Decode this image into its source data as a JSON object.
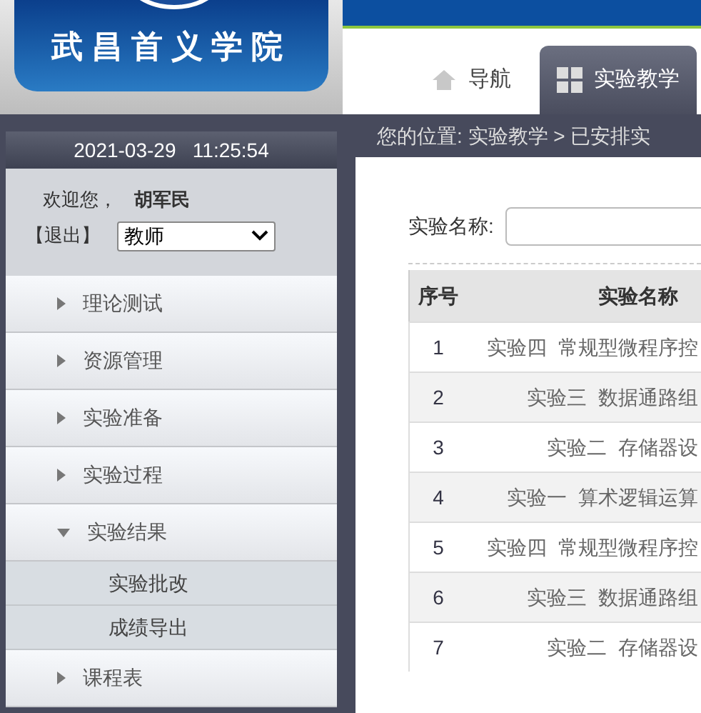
{
  "header": {
    "school_name": "武昌首义学院",
    "tabs": [
      {
        "label": "导航",
        "kind": "home",
        "selected": false
      },
      {
        "label": "实验教学",
        "kind": "grid",
        "selected": true
      }
    ]
  },
  "sidebar": {
    "datetime": "2021-03-29   11:25:54",
    "welcome": "欢迎您，",
    "user": "胡军民",
    "logout": "【退出】",
    "role": "教师",
    "menu": [
      {
        "label": "理论测试",
        "expanded": false
      },
      {
        "label": "资源管理",
        "expanded": false
      },
      {
        "label": "实验准备",
        "expanded": false
      },
      {
        "label": "实验过程",
        "expanded": false
      },
      {
        "label": "实验结果",
        "expanded": true,
        "children": [
          {
            "label": "实验批改"
          },
          {
            "label": "成绩导出"
          }
        ]
      },
      {
        "label": "课程表",
        "expanded": false
      }
    ]
  },
  "breadcrumb": "您的位置: 实验教学 > 已安排实",
  "search": {
    "label": "实验名称:"
  },
  "table": {
    "columns": [
      "序号",
      "实验名称"
    ],
    "rows": [
      [
        "1",
        "实验四  常规型微程序控"
      ],
      [
        "2",
        "实验三  数据通路组"
      ],
      [
        "3",
        "实验二  存储器设"
      ],
      [
        "4",
        "实验一  算术逻辑运算"
      ],
      [
        "5",
        "实验四  常规型微程序控"
      ],
      [
        "6",
        "实验三  数据通路组"
      ],
      [
        "7",
        "实验二  存储器设"
      ]
    ]
  }
}
